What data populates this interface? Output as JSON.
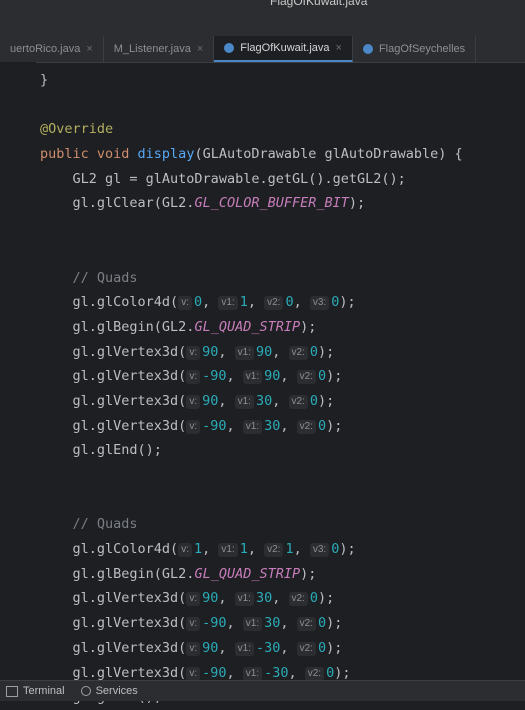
{
  "window": {
    "title": "FlagOfKuwait.java"
  },
  "tabs": [
    {
      "label": "uertoRico.java",
      "active": false
    },
    {
      "label": "M_Listener.java",
      "active": false
    },
    {
      "label": "FlagOfKuwait.java",
      "active": true
    },
    {
      "label": "FlagOfSeychelles",
      "active": false
    }
  ],
  "code": {
    "l0": "}",
    "l1": "@Override",
    "l2_kw": "public void",
    "l2_fn": "display",
    "l2_rest": "(GLAutoDrawable glAutoDrawable) {",
    "l3": "GL2 gl = glAutoDrawable.getGL().getGL2();",
    "l4_a": "gl.glClear(GL2.",
    "l4_const": "GL_COLOR_BUFFER_BIT",
    "l4_b": ");",
    "c1": "// Quads",
    "c2": "// Quads",
    "b1": {
      "color_call": "gl.glColor4d(",
      "color_args": [
        [
          "v:",
          "0"
        ],
        [
          "v1:",
          "1"
        ],
        [
          "v2:",
          "0"
        ],
        [
          "v3:",
          "0"
        ]
      ],
      "begin_a": "gl.glBegin(GL2.",
      "begin_const": "GL_QUAD_STRIP",
      "begin_b": ");",
      "vertices": [
        [
          [
            "v:",
            "90"
          ],
          [
            "v1:",
            "90"
          ],
          [
            "v2:",
            "0"
          ]
        ],
        [
          [
            "v:",
            "-90"
          ],
          [
            "v1:",
            "90"
          ],
          [
            "v2:",
            "0"
          ]
        ],
        [
          [
            "v:",
            "90"
          ],
          [
            "v1:",
            "30"
          ],
          [
            "v2:",
            "0"
          ]
        ],
        [
          [
            "v:",
            "-90"
          ],
          [
            "v1:",
            "30"
          ],
          [
            "v2:",
            "0"
          ]
        ]
      ],
      "end": "gl.glEnd();"
    },
    "b2": {
      "color_call": "gl.glColor4d(",
      "color_args": [
        [
          "v:",
          "1"
        ],
        [
          "v1:",
          "1"
        ],
        [
          "v2:",
          "1"
        ],
        [
          "v3:",
          "0"
        ]
      ],
      "begin_a": "gl.glBegin(GL2.",
      "begin_const": "GL_QUAD_STRIP",
      "begin_b": ");",
      "vertices": [
        [
          [
            "v:",
            "90"
          ],
          [
            "v1:",
            "30"
          ],
          [
            "v2:",
            "0"
          ]
        ],
        [
          [
            "v:",
            "-90"
          ],
          [
            "v1:",
            "30"
          ],
          [
            "v2:",
            "0"
          ]
        ],
        [
          [
            "v:",
            "90"
          ],
          [
            "v1:",
            "-30"
          ],
          [
            "v2:",
            "0"
          ]
        ],
        [
          [
            "v:",
            "-90"
          ],
          [
            "v1:",
            "-30"
          ],
          [
            "v2:",
            "0"
          ]
        ]
      ],
      "end": "gl.glEnd();"
    },
    "vertex_call": "gl.glVertex3d(",
    "close": ");"
  },
  "statusbar": {
    "terminal": "Terminal",
    "services": "Services"
  },
  "icons": {
    "tab_file": "java-file-icon",
    "terminal": "terminal-icon",
    "services": "services-icon"
  }
}
